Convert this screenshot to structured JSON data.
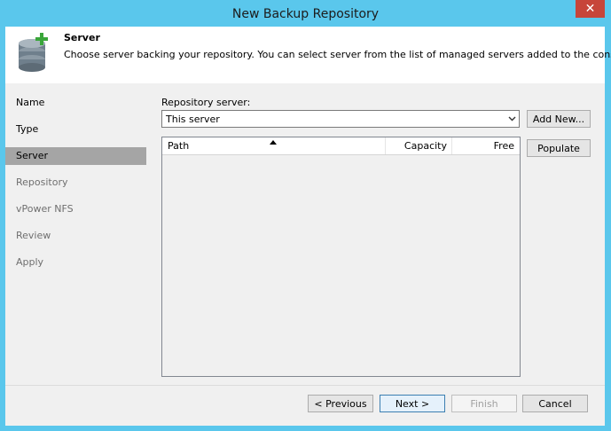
{
  "window": {
    "title": "New Backup Repository",
    "close_glyph": "✕",
    "close_icon": "close-icon"
  },
  "header": {
    "title": "Server",
    "description": "Choose server backing your repository. You can select server from the list of managed servers added to the console.",
    "icon": "database-add-icon",
    "colors": {
      "plus": "#3aa63a",
      "database": "#6f7f8c"
    }
  },
  "nav": {
    "items": [
      {
        "label": "Name",
        "state": "done"
      },
      {
        "label": "Type",
        "state": "done"
      },
      {
        "label": "Server",
        "state": "active"
      },
      {
        "label": "Repository",
        "state": "pending"
      },
      {
        "label": "vPower NFS",
        "state": "pending"
      },
      {
        "label": "Review",
        "state": "pending"
      },
      {
        "label": "Apply",
        "state": "pending"
      }
    ]
  },
  "main": {
    "repository_server_label": "Repository server:",
    "repository_server_value": "This server",
    "add_new_label": "Add New...",
    "populate_label": "Populate",
    "table": {
      "columns": [
        "Path",
        "Capacity",
        "Free"
      ],
      "rows": []
    }
  },
  "footer": {
    "previous_label": "< Previous",
    "next_label": "Next >",
    "finish_label": "Finish",
    "cancel_label": "Cancel"
  },
  "colors": {
    "window_frame": "#5ac7ec",
    "active_nav": "#a5a5a5",
    "close_button": "#c7453a"
  }
}
